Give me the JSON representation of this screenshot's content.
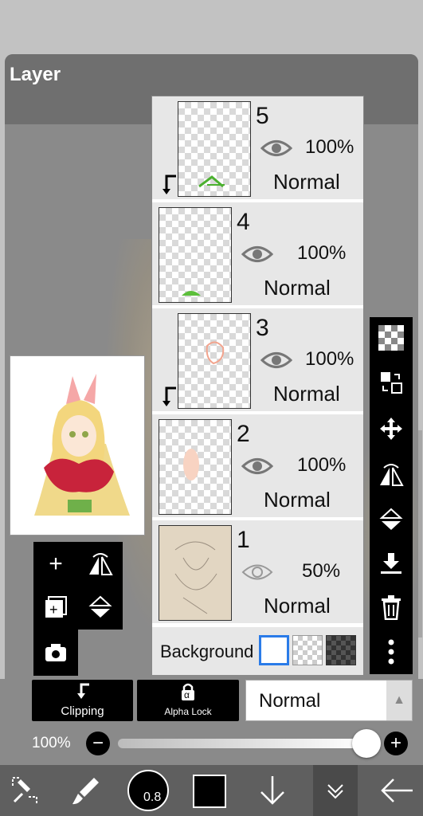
{
  "panel": {
    "title": "Layer"
  },
  "layers": [
    {
      "number": "5",
      "opacity": "100%",
      "blend": "Normal",
      "visible": true,
      "clipped": true
    },
    {
      "number": "4",
      "opacity": "100%",
      "blend": "Normal",
      "visible": true,
      "clipped": false
    },
    {
      "number": "3",
      "opacity": "100%",
      "blend": "Normal",
      "visible": true,
      "clipped": true
    },
    {
      "number": "2",
      "opacity": "100%",
      "blend": "Normal",
      "visible": true,
      "clipped": false
    },
    {
      "number": "1",
      "opacity": "50%",
      "blend": "Normal",
      "visible": true,
      "clipped": false
    }
  ],
  "background": {
    "label": "Background"
  },
  "buttons": {
    "clipping": "Clipping",
    "alpha_lock": "Alpha Lock",
    "alpha_symbol": "α"
  },
  "blend_mode": {
    "value": "Normal"
  },
  "opacity": {
    "label": "100%",
    "value": 100
  },
  "toolbar": {
    "brush_size": "0.8"
  },
  "colors": {
    "accent": "#2a7be8",
    "panel": "#8a8a8a",
    "toolbar": "#5f5f5f"
  }
}
